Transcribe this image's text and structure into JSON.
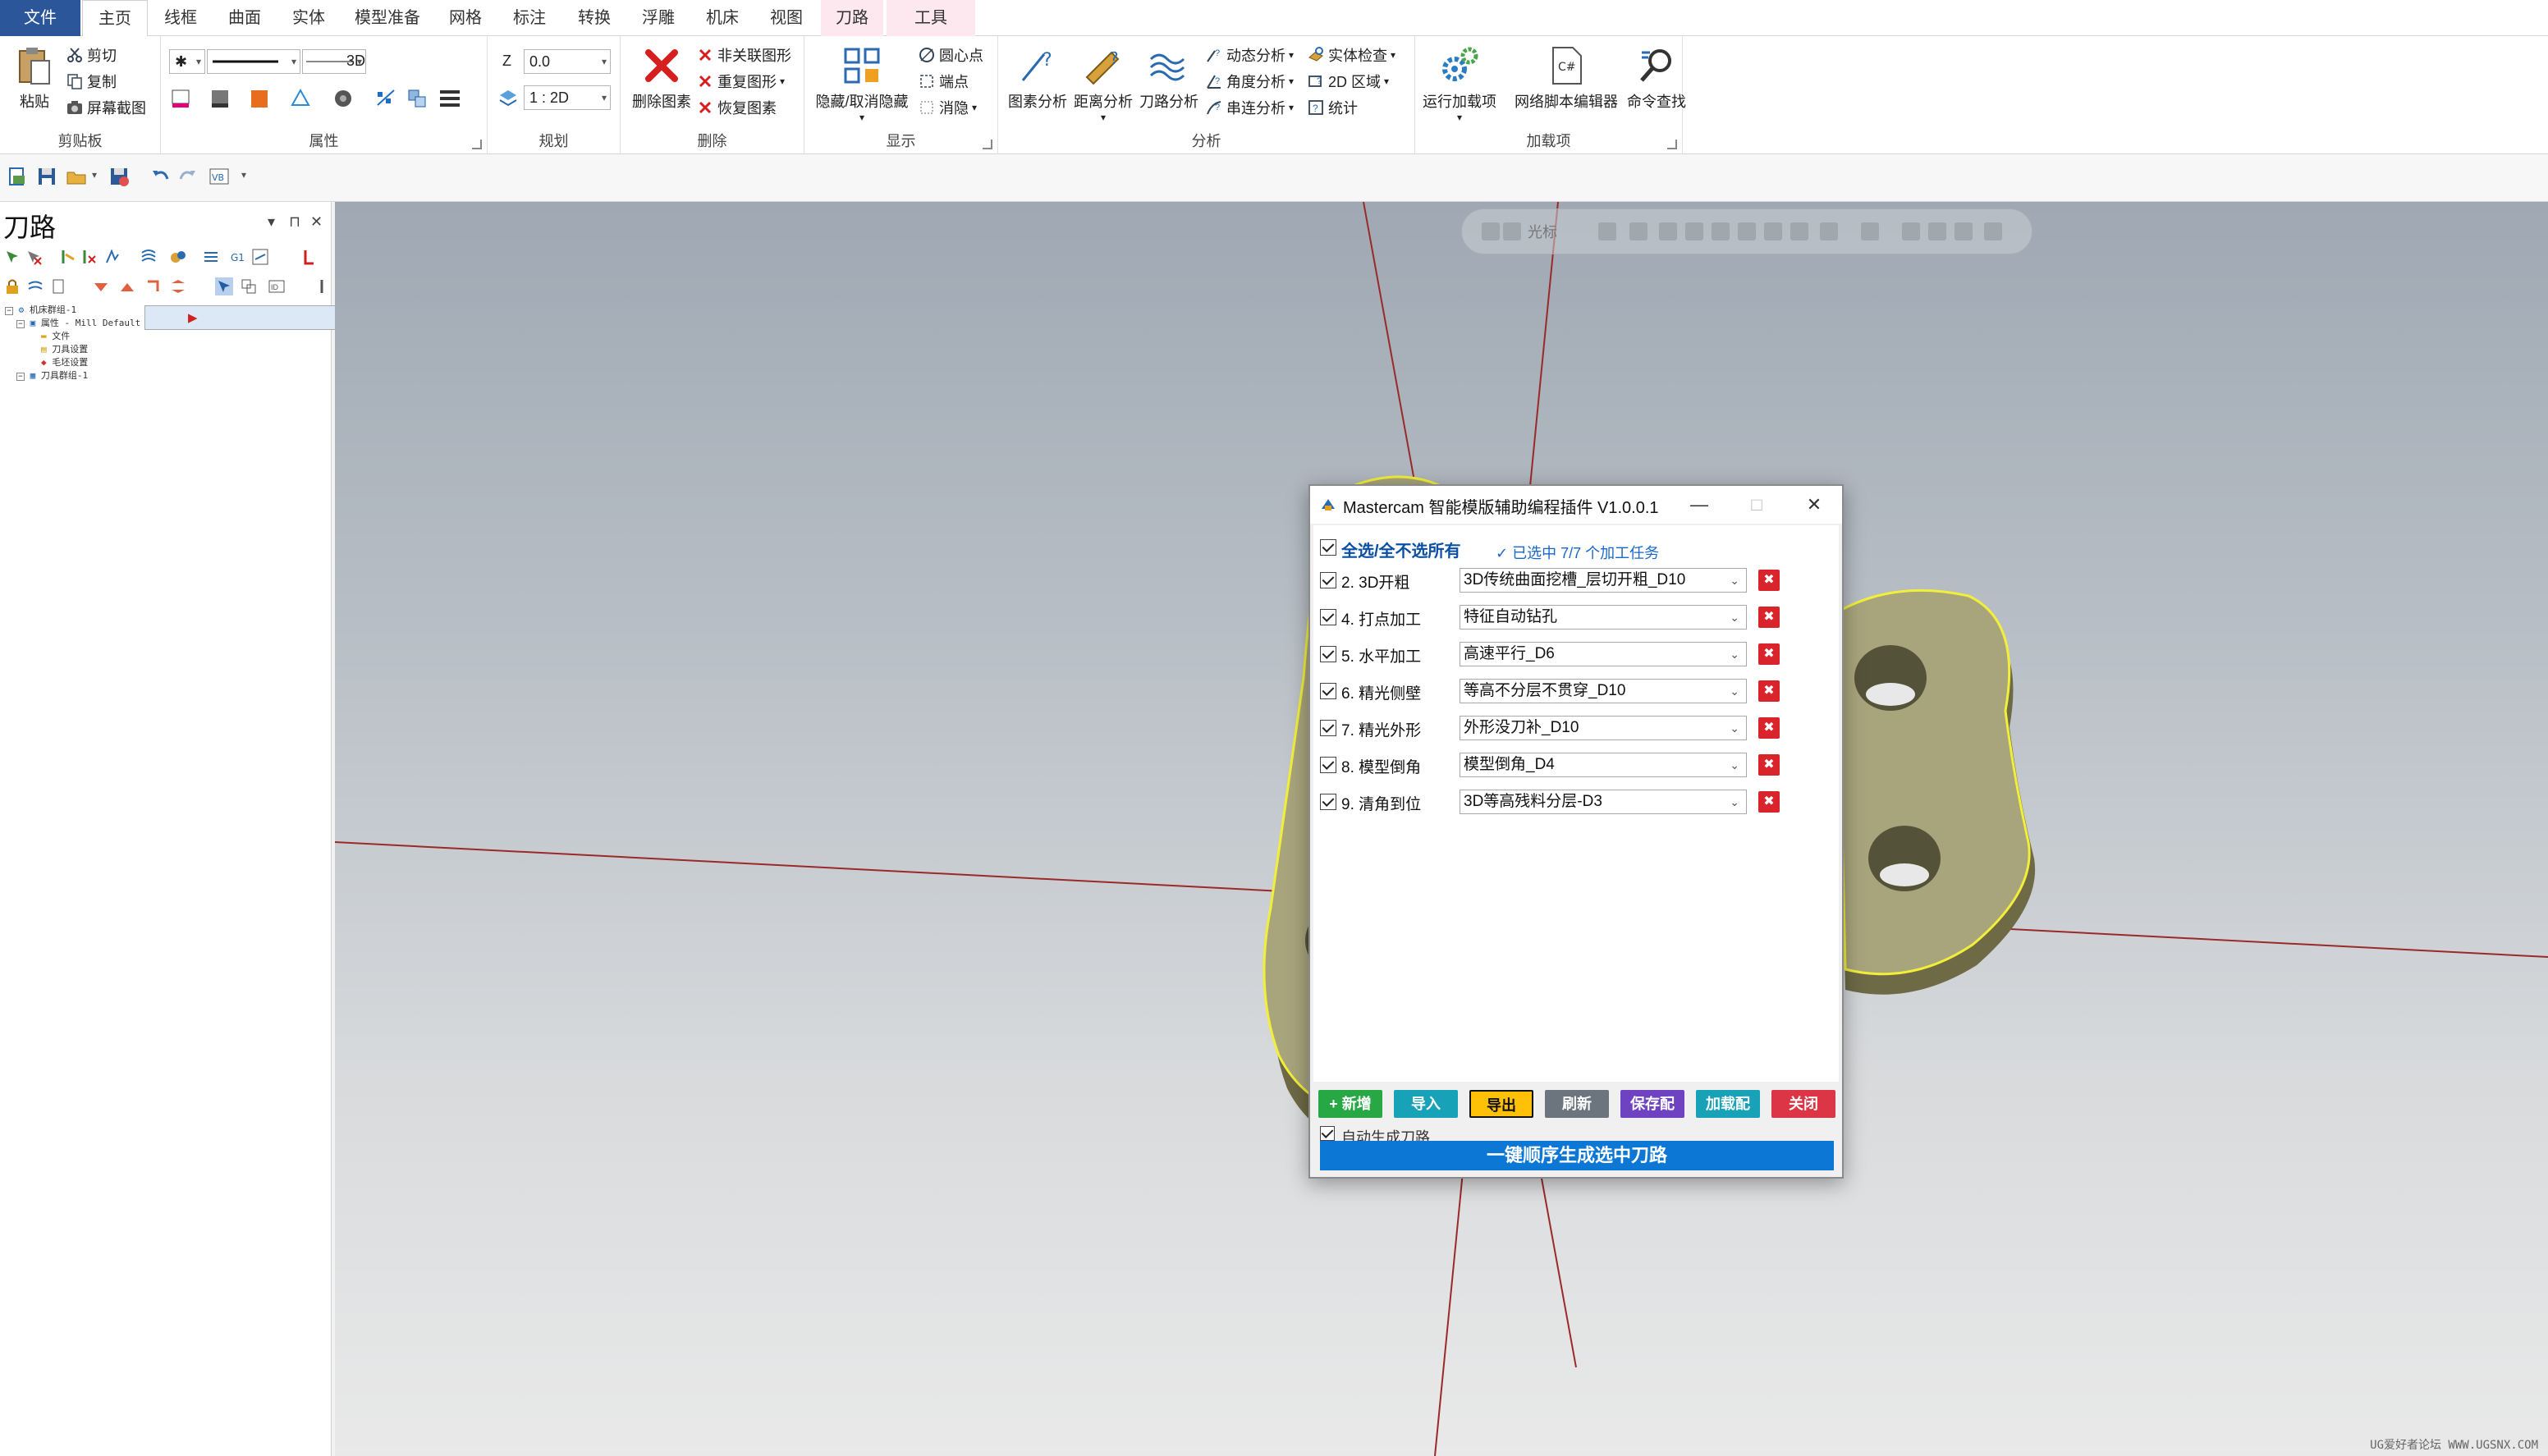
{
  "tabs": [
    "文件",
    "主页",
    "线框",
    "曲面",
    "实体",
    "模型准备",
    "网格",
    "标注",
    "转换",
    "浮雕",
    "机床",
    "视图",
    "刀路",
    "工具"
  ],
  "ribbon": {
    "clipboard": {
      "label": "剪贴板",
      "paste": "粘贴",
      "cut": "剪切",
      "copy": "复制",
      "screenshot": "屏幕截图"
    },
    "attributes": {
      "label": "属性",
      "mode": "3D"
    },
    "planning": {
      "label": "规划",
      "z_label": "Z",
      "z_value": "0.0",
      "level_value": "1 : 2D"
    },
    "delete": {
      "label": "删除",
      "delete_entities": "删除图素",
      "non_assoc": "非关联图形",
      "repeat": "重复图形",
      "restore": "恢复图素"
    },
    "display": {
      "label": "显示",
      "hide_unhide": "隐藏/取消隐藏",
      "center_point": "圆心点",
      "endpoint": "端点",
      "blank": "消隐"
    },
    "analysis": {
      "label": "分析",
      "entity": "图素分析",
      "distance": "距离分析",
      "toolpath": "刀路分析",
      "dynamic": "动态分析",
      "angle": "角度分析",
      "chain": "串连分析",
      "solid_check": "实体检查",
      "region_2d": "2D 区域",
      "statistics": "统计"
    },
    "addins": {
      "label": "加载项",
      "run": "运行加载项",
      "net_editor": "网络脚本编辑器",
      "command_find": "命令查找",
      "cs_badge": "C#"
    }
  },
  "left_panel": {
    "title": "刀路",
    "tree": [
      "机床群组-1",
      "属性 - Mill Default MM",
      "文件",
      "刀具设置",
      "毛坯设置",
      "刀具群组-1"
    ]
  },
  "viewport": {
    "toolbar_label": "光标",
    "watermark": "UG爱好者论坛 WWW.UGSNX.COM"
  },
  "dialog": {
    "title": "Mastercam 智能模版辅助编程插件 V1.0.0.1",
    "select_all": "全选/全不选所有",
    "selected_count": "✓ 已选中 7/7 个加工任务",
    "rows": [
      {
        "label": "2. 3D开粗",
        "value": "3D传统曲面挖槽_层切开粗_D10"
      },
      {
        "label": "4. 打点加工",
        "value": "特征自动钻孔"
      },
      {
        "label": "5. 水平加工",
        "value": "高速平行_D6"
      },
      {
        "label": "6. 精光侧壁",
        "value": "等高不分层不贯穿_D10"
      },
      {
        "label": "7. 精光外形",
        "value": "外形没刀补_D10"
      },
      {
        "label": "8. 模型倒角",
        "value": "模型倒角_D4"
      },
      {
        "label": "9. 清角到位",
        "value": "3D等高残料分层-D3"
      }
    ],
    "buttons": {
      "add": "+ 新增",
      "import": "导入",
      "export": "导出",
      "refresh": "刷新",
      "save_config": "保存配",
      "load_config": "加载配",
      "close": "关闭"
    },
    "auto_generate": "自动生成刀路",
    "generate_button": "一键顺序生成选中刀路"
  },
  "colors": {
    "file_tab": "#2b579a",
    "part_fill": "#a8a47c",
    "highlight": "#f2ef3a",
    "generate": "#0d77d6"
  }
}
